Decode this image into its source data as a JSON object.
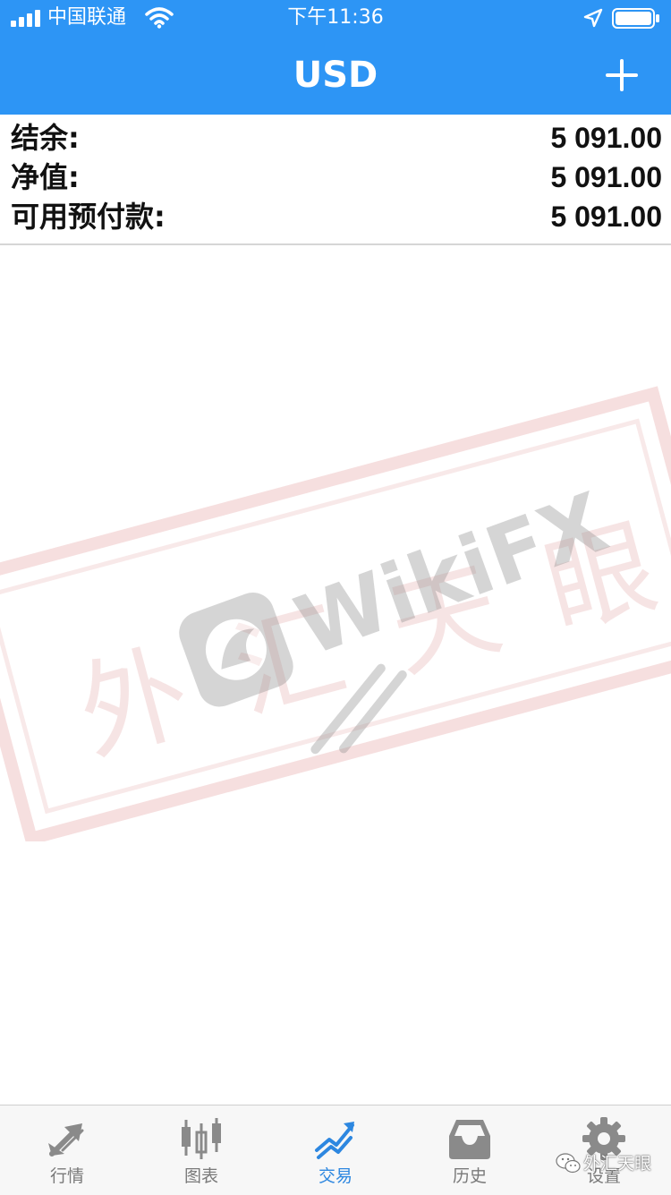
{
  "status_bar": {
    "carrier": "中国联通",
    "time": "下午11:36"
  },
  "nav": {
    "title": "USD",
    "add_icon": "plus-icon"
  },
  "summary": [
    {
      "label": "结余:",
      "value": "5 091.00"
    },
    {
      "label": "净值:",
      "value": "5 091.00"
    },
    {
      "label": "可用预付款:",
      "value": "5 091.00"
    }
  ],
  "watermark": {
    "brand": "WikiFX",
    "stamp_text": "外汇天眼"
  },
  "tabs": [
    {
      "label": "行情",
      "icon": "quotes-arrows-icon",
      "active": false
    },
    {
      "label": "图表",
      "icon": "candlestick-chart-icon",
      "active": false
    },
    {
      "label": "交易",
      "icon": "trade-trend-icon",
      "active": true
    },
    {
      "label": "历史",
      "icon": "history-inbox-icon",
      "active": false
    },
    {
      "label": "设置",
      "icon": "gear-icon",
      "active": false
    }
  ],
  "wechat_watermark": {
    "text": "外汇天眼",
    "icon": "wechat-icon"
  },
  "colors": {
    "brand_blue": "#2d95f5",
    "active_tab": "#2d87e0",
    "inactive_tab": "#7a7a7a",
    "watermark_red": "#e8b9b9"
  }
}
